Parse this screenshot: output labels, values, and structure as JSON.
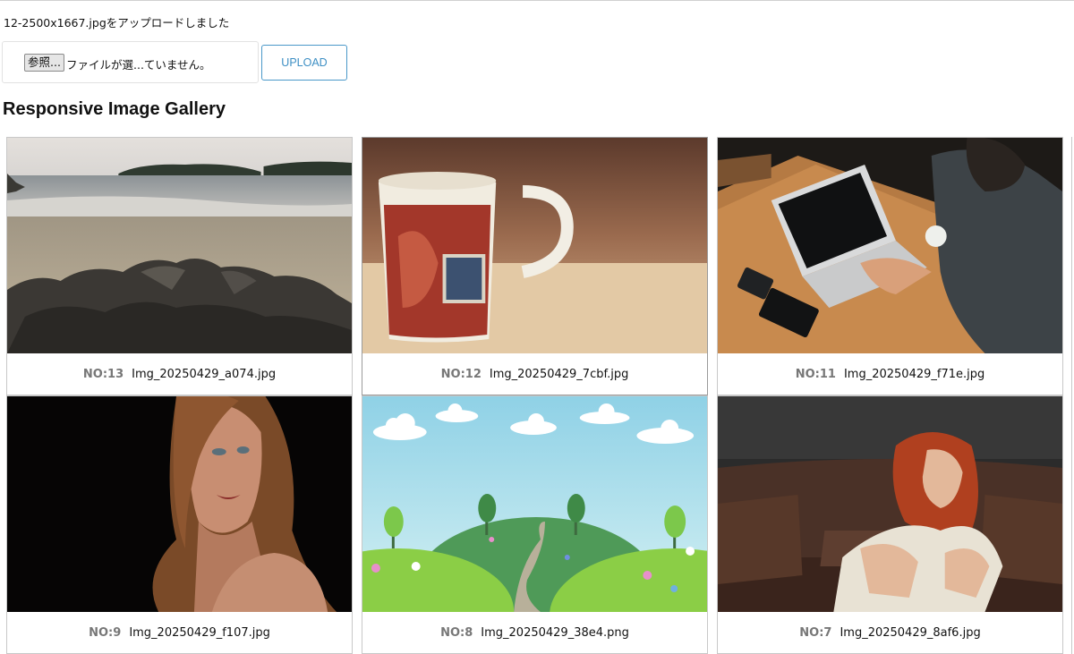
{
  "status_message": "12-2500x1667.jpgをアップロードしました",
  "uploader": {
    "browse_label": "参照...",
    "file_status": "ファイルが選...ていません。",
    "upload_label": "UPLOAD"
  },
  "gallery": {
    "title": "Responsive Image Gallery",
    "items": [
      {
        "no": "NO:13",
        "filename": "Img_20250429_a074.jpg",
        "image": "beach-rocks-photo"
      },
      {
        "no": "NO:12",
        "filename": "Img_20250429_7cbf.jpg",
        "image": "mug-photo"
      },
      {
        "no": "NO:11",
        "filename": "Img_20250429_f71e.jpg",
        "image": "laptop-photo"
      },
      {
        "no": "NO:9",
        "filename": "Img_20250429_f107.jpg",
        "image": "portrait-photo"
      },
      {
        "no": "NO:8",
        "filename": "Img_20250429_38e4.png",
        "image": "hills-illustration"
      },
      {
        "no": "NO:7",
        "filename": "Img_20250429_8af6.jpg",
        "image": "sofa-photo"
      }
    ]
  }
}
